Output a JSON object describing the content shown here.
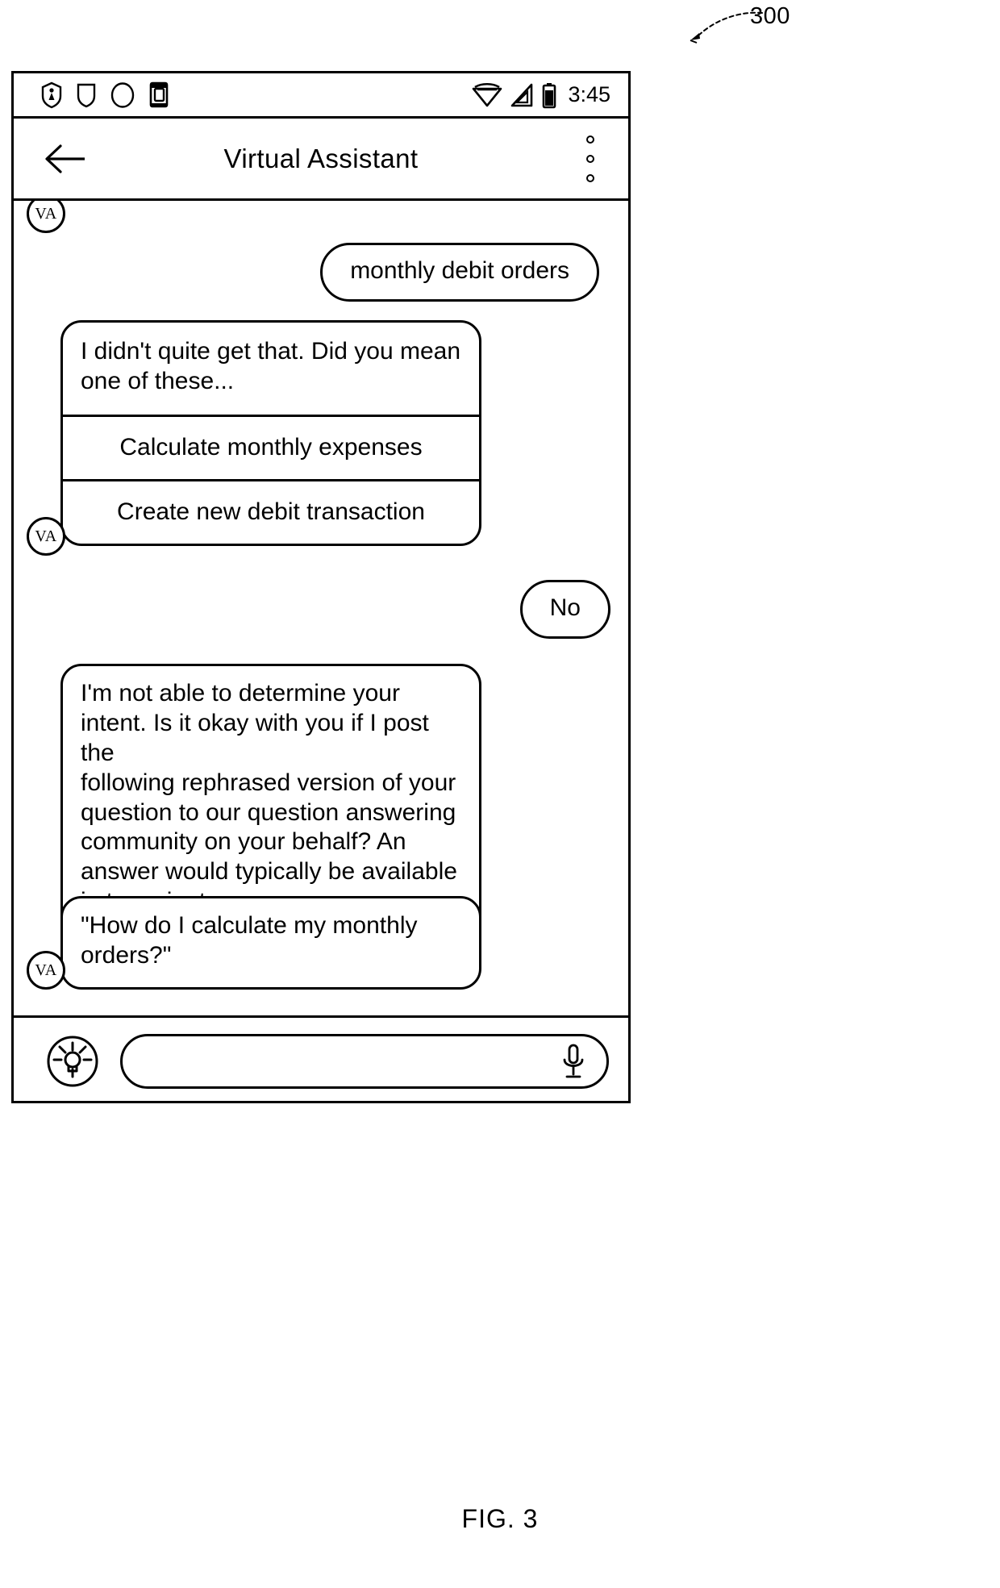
{
  "figure": {
    "reference_numeral": "300",
    "caption": "FIG. 3"
  },
  "status_bar": {
    "time": "3:45",
    "left_icons": [
      "shield-notification-icon",
      "download-badge-icon",
      "circle-status-icon",
      "sim-card-icon"
    ],
    "right_icons": [
      "wifi-icon",
      "cellular-signal-icon",
      "battery-icon"
    ]
  },
  "app_bar": {
    "title": "Virtual Assistant",
    "back_label": "Back",
    "overflow_label": "More options"
  },
  "conversation": {
    "avatar_label": "VA",
    "messages": [
      {
        "sender": "user",
        "text": "monthly debit orders"
      },
      {
        "sender": "assistant",
        "text_line_1": "I didn't quite get that. Did you mean",
        "text_line_2": "one of these...",
        "options": [
          "Calculate monthly expenses",
          "Create new debit transaction"
        ]
      },
      {
        "sender": "user",
        "text": "No"
      },
      {
        "sender": "assistant",
        "lines": [
          "I'm not able to determine your",
          "intent. Is it okay with you if I post the",
          "following rephrased version of your",
          "question to our question answering",
          "community on your behalf? An",
          "answer would typically be available",
          "in ten minutes."
        ]
      },
      {
        "sender": "assistant",
        "lines": [
          "\"How do I calculate my monthly",
          "orders?\""
        ]
      }
    ]
  },
  "composer": {
    "suggestion_icon": "lightbulb-icon",
    "input_value": "",
    "input_placeholder": "",
    "mic_icon": "microphone-icon"
  }
}
